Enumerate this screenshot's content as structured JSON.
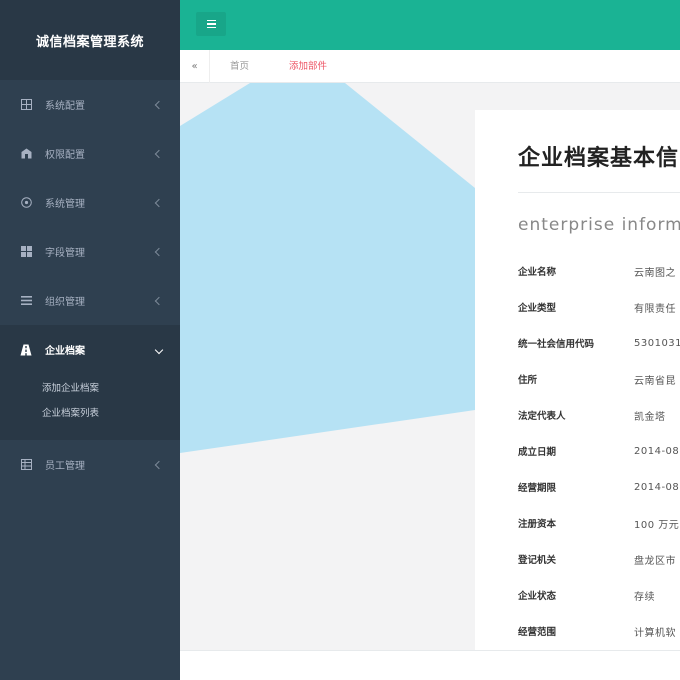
{
  "app": {
    "title": "诚信档案管理系统"
  },
  "colors": {
    "sidebar": "#2f4050",
    "accent": "#1ab394",
    "active_tab": "#ed5565",
    "decor": "#b6e2f4"
  },
  "sidebar": {
    "items": [
      {
        "label": "系统配置",
        "icon": "grid-icon"
      },
      {
        "label": "权限配置",
        "icon": "building-icon"
      },
      {
        "label": "系统管理",
        "icon": "target-icon"
      },
      {
        "label": "字段管理",
        "icon": "table-icon"
      },
      {
        "label": "组织管理",
        "icon": "list-icon"
      },
      {
        "label": "企业档案",
        "icon": "road-icon",
        "expanded": true
      },
      {
        "label": "员工管理",
        "icon": "table-icon"
      }
    ],
    "submenu": [
      {
        "label": "添加企业档案"
      },
      {
        "label": "企业档案列表"
      }
    ]
  },
  "tabs": [
    {
      "label": "首页"
    },
    {
      "label": "添加部件",
      "active": true
    }
  ],
  "card": {
    "title": "企业档案基本信",
    "subtitle": "enterprise inform",
    "rows": [
      {
        "label": "企业名称",
        "value": "云南图之"
      },
      {
        "label": "企业类型",
        "value": "有限责任"
      },
      {
        "label": "统一社会信用代码",
        "value": "5301031"
      },
      {
        "label": "住所",
        "value": "云南省昆"
      },
      {
        "label": "法定代表人",
        "value": "凯金塔"
      },
      {
        "label": "成立日期",
        "value": "2014-08"
      },
      {
        "label": "经营期限",
        "value": "2014-08"
      },
      {
        "label": "注册资本",
        "value": "100 万元"
      },
      {
        "label": "登记机关",
        "value": "盘龙区市"
      },
      {
        "label": "企业状态",
        "value": "存续"
      },
      {
        "label": "经营范围",
        "value": "计算机软"
      }
    ]
  }
}
